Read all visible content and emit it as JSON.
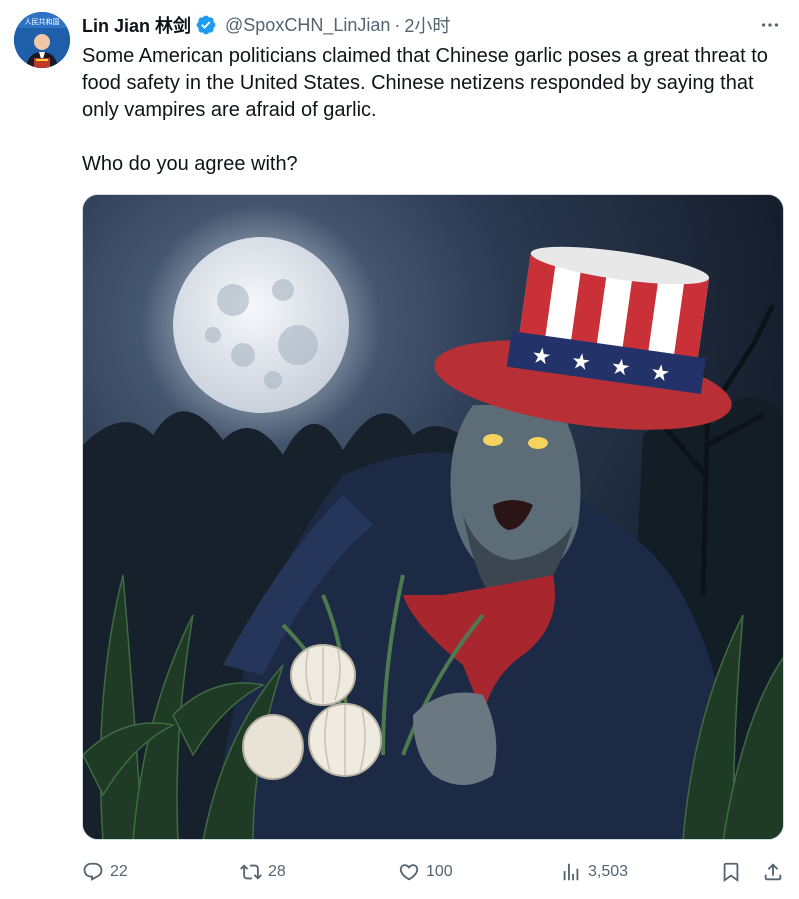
{
  "tweet": {
    "display_name": "Lin Jian 林剑",
    "handle": "@SpoxCHN_LinJian",
    "separator": "·",
    "time": "2小时",
    "paragraphs": [
      "Some American politicians claimed that Chinese garlic poses a great threat to food safety in the United States. Chinese netizens responded by saying that only vampires are afraid of garlic.",
      "Who do you agree with?"
    ]
  },
  "avatar": {
    "sign_text": "人民共和国"
  },
  "icons": {
    "more": "more-horizontal-icon",
    "verified": "verified-badge-icon",
    "reply": "reply-icon",
    "retweet": "retweet-icon",
    "like": "heart-icon",
    "views": "views-bar-chart-icon",
    "bookmark": "bookmark-icon",
    "share": "share-icon"
  },
  "colors": {
    "verified": "#1d9bf0",
    "secondary_text": "#536471"
  },
  "actions": {
    "replies": "22",
    "retweets": "28",
    "likes": "100",
    "views": "3,503"
  }
}
